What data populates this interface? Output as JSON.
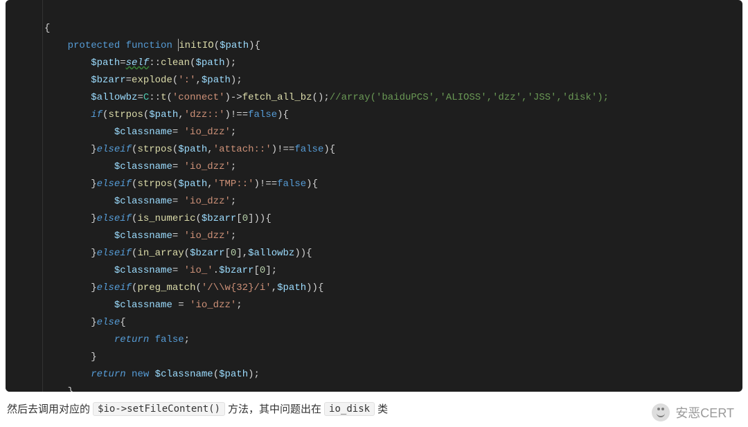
{
  "code": {
    "l1": {
      "brace": "{"
    },
    "l2": {
      "kw_protected": "protected",
      "kw_function": "function",
      "fn": "initIO",
      "lp": "(",
      "p_path": "$path",
      "rp": ")",
      "ob": "{"
    },
    "l3": {
      "v_path": "$path",
      "op": "=",
      "self": "self",
      "dc": "::",
      "fn": "clean",
      "lp": "(",
      "arg": "$path",
      "rp": ")",
      "sc": ";"
    },
    "l4": {
      "v_bzarr": "$bzarr",
      "op": "=",
      "fn": "explode",
      "lp": "(",
      "s1": "':'",
      "cm": ",",
      "v_path": "$path",
      "rp": ")",
      "sc": ";"
    },
    "l5": {
      "v_allowbz": "$allowbz",
      "op": "=",
      "cls": "C",
      "dc": "::",
      "fn": "t",
      "lp": "(",
      "s1": "'connect'",
      "rp": ")",
      "arrow": "->",
      "fn2": "fetch_all_bz",
      "lp2": "(",
      "rp2": ")",
      "sc": ";",
      "cmt": "//array('baiduPCS','ALIOSS','dzz','JSS','disk');"
    },
    "l6": {
      "kw_if": "if",
      "lp": "(",
      "fn": "strpos",
      "lp2": "(",
      "v_path": "$path",
      "cm": ",",
      "s1": "'dzz::'",
      "rp2": ")",
      "nop": "!==",
      "false": "false",
      "rp": ")",
      "ob": "{"
    },
    "l7": {
      "v": "$classname",
      "op": "= ",
      "s": "'io_dzz'",
      "sc": ";"
    },
    "l8": {
      "cb": "}",
      "kw": "elseif",
      "lp": "(",
      "fn": "strpos",
      "lp2": "(",
      "v_path": "$path",
      "cm": ",",
      "s1": "'attach::'",
      "rp2": ")",
      "nop": "!==",
      "false": "false",
      "rp": ")",
      "ob": "{"
    },
    "l9": {
      "v": "$classname",
      "op": "= ",
      "s": "'io_dzz'",
      "sc": ";"
    },
    "l10": {
      "cb": "}",
      "kw": "elseif",
      "lp": "(",
      "fn": "strpos",
      "lp2": "(",
      "v_path": "$path",
      "cm": ",",
      "s1": "'TMP::'",
      "rp2": ")",
      "nop": "!==",
      "false": "false",
      "rp": ")",
      "ob": "{"
    },
    "l11": {
      "v": "$classname",
      "op": "= ",
      "s": "'io_dzz'",
      "sc": ";"
    },
    "l12": {
      "cb": "}",
      "kw": "elseif",
      "lp": "(",
      "fn": "is_numeric",
      "lp2": "(",
      "v": "$bzarr",
      "lb": "[",
      "idx": "0",
      "rb": "]",
      "rp2": ")",
      "rp": ")",
      "ob": "{"
    },
    "l13": {
      "v": "$classname",
      "op": "= ",
      "s": "'io_dzz'",
      "sc": ";"
    },
    "l14": {
      "cb": "}",
      "kw": "elseif",
      "lp": "(",
      "fn": "in_array",
      "lp2": "(",
      "v": "$bzarr",
      "lb": "[",
      "idx": "0",
      "rb": "]",
      "cm": ",",
      "v2": "$allowbz",
      "rp2": ")",
      "rp": ")",
      "ob": "{"
    },
    "l15": {
      "v": "$classname",
      "op": "= ",
      "s": "'io_'",
      "dot": ".",
      "v2": "$bzarr",
      "lb": "[",
      "idx": "0",
      "rb": "]",
      "sc": ";"
    },
    "l16": {
      "cb": "}",
      "kw": "elseif",
      "lp": "(",
      "fn": "preg_match",
      "lp2": "(",
      "s1": "'/\\\\w{32}/i'",
      "cm": ",",
      "v_path": "$path",
      "rp2": ")",
      "rp": ")",
      "ob": "{"
    },
    "l17": {
      "v": "$classname",
      "op": " = ",
      "s": "'io_dzz'",
      "sc": ";"
    },
    "l18": {
      "cb": "}",
      "kw": "else",
      "ob": "{"
    },
    "l19": {
      "kw": "return",
      "sp": " ",
      "false": "false",
      "sc": ";"
    },
    "l20": {
      "cb": "}"
    },
    "l21": {
      "kw": "return",
      "sp": " ",
      "kwnew": "new",
      "sp2": " ",
      "v": "$classname",
      "lp": "(",
      "arg": "$path",
      "rp": ")",
      "sc": ";"
    },
    "l22": {
      "cb": "}"
    }
  },
  "caption": {
    "t1": "然后去调用对应的",
    "code1": "$io->setFileContent()",
    "t2": "方法，其中问题出在",
    "code2": "io_disk",
    "t3": "类"
  },
  "watermark": {
    "text": "安恶CERT"
  }
}
